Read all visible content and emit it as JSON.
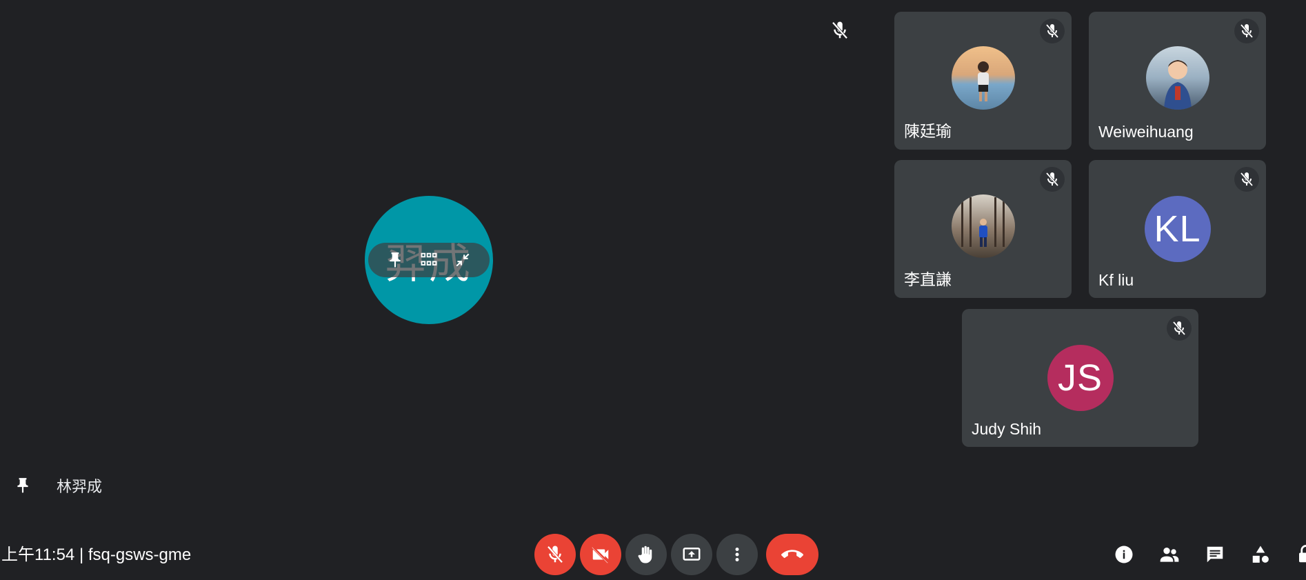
{
  "main_speaker": {
    "name": "林羿成",
    "avatar_text": "羿成",
    "avatar_color": "#0097a7"
  },
  "participants": [
    {
      "name": "陳廷瑜",
      "avatar": "photo",
      "photo_colors": [
        "#f0c08a",
        "#7aa7c9"
      ]
    },
    {
      "name": "Weiweihuang",
      "avatar": "photo",
      "photo_colors": [
        "#9ab0c2",
        "#3b5a8a"
      ]
    },
    {
      "name": "李直謙",
      "avatar": "photo",
      "photo_colors": [
        "#8b7a6a",
        "#4a4036"
      ]
    },
    {
      "name": "Kf liu",
      "avatar": "initials",
      "initials": "KL",
      "color": "#5c6bc0"
    },
    {
      "name": "Judy Shih",
      "avatar": "initials",
      "initials": "JS",
      "color": "#b52d5e"
    }
  ],
  "meeting": {
    "time": "上午11:54",
    "separator": "|",
    "code": "fsq-gsws-gme"
  },
  "controls": {
    "mic": "mic-off-icon",
    "camera": "videocam-off-icon",
    "raise_hand": "raise-hand-icon",
    "present": "present-screen-icon",
    "more": "more-vert-icon",
    "end_call": "call-end-icon"
  },
  "side_panel_icons": [
    "info-icon",
    "people-icon",
    "chat-icon",
    "activities-icon",
    "host-controls-icon"
  ],
  "colors": {
    "background": "#202124",
    "tile": "#3c4043",
    "danger": "#ea4335"
  }
}
